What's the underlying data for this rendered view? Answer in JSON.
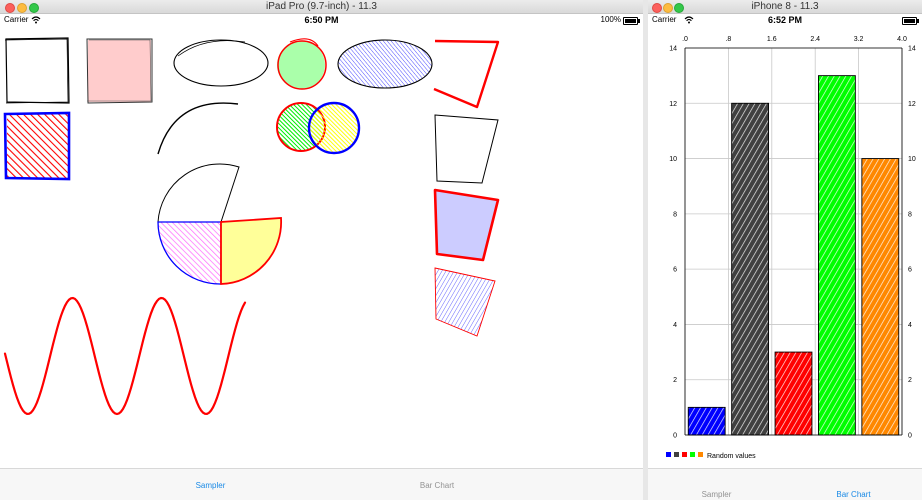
{
  "ipad": {
    "window_title": "iPad Pro (9.7-inch) - 11.3",
    "status": {
      "carrier": "Carrier",
      "time": "6:50 PM",
      "battery": "100%"
    },
    "tabs": [
      {
        "label": "Sampler",
        "selected": true
      },
      {
        "label": "Bar Chart",
        "selected": false
      }
    ],
    "shapes": [
      {
        "name": "rectangle",
        "stroke": "#000000",
        "fill": "none"
      },
      {
        "name": "filled-rectangle",
        "stroke": "#333333",
        "fill": "#ffcccc"
      },
      {
        "name": "ellipse",
        "stroke": "#000000",
        "fill": "none"
      },
      {
        "name": "circle-filled",
        "stroke": "#ff0000",
        "fill": "#aaffaa"
      },
      {
        "name": "ellipse-hachure",
        "stroke": "#000000",
        "fill": "#0000ff"
      },
      {
        "name": "polyline",
        "stroke": "#ff0000"
      },
      {
        "name": "rectangle-hachure",
        "stroke": "#0000ff",
        "fill": "#ff0000"
      },
      {
        "name": "arc",
        "stroke": "#000000"
      },
      {
        "name": "circle-green",
        "stroke": "#ff0000",
        "fill": "#00ff00"
      },
      {
        "name": "circle-yellow",
        "stroke": "#0000ff",
        "fill": "#ffff00"
      },
      {
        "name": "polygon-outline",
        "stroke": "#000000"
      },
      {
        "name": "pie-outline",
        "stroke": "#000000"
      },
      {
        "name": "pie-violet",
        "stroke": "#0000ff",
        "fill": "#ff88ff"
      },
      {
        "name": "pie-yellow",
        "stroke": "#ff0000",
        "fill": "#ffff88"
      },
      {
        "name": "polygon-lavender",
        "stroke": "#ff0000",
        "fill": "#ccccff"
      },
      {
        "name": "polygon-hachure",
        "stroke": "#ff0000",
        "fill": "#0000ff"
      },
      {
        "name": "sine-wave",
        "stroke": "#ff0000"
      }
    ]
  },
  "iphone": {
    "window_title": "iPhone 8 - 11.3",
    "status": {
      "carrier": "Carrier",
      "time": "6:52 PM"
    },
    "tabs": [
      {
        "label": "Sampler",
        "selected": false
      },
      {
        "label": "Bar Chart",
        "selected": true
      }
    ]
  },
  "chart_data": {
    "type": "bar",
    "categories": [
      ".0",
      ".8",
      "1.6",
      "2.4",
      "3.2",
      "4.0"
    ],
    "bars": [
      {
        "x": 0.0,
        "value": 1,
        "color": "#0000ff"
      },
      {
        "x": 1.0,
        "value": 12,
        "color": "#404040"
      },
      {
        "x": 2.0,
        "value": 3,
        "color": "#ff0000"
      },
      {
        "x": 3.0,
        "value": 13,
        "color": "#00ff00"
      },
      {
        "x": 4.0,
        "value": 10,
        "color": "#ff8800"
      }
    ],
    "x_ticks": [
      ".0",
      ".8",
      "1.6",
      "2.4",
      "3.2",
      "4.0"
    ],
    "y_ticks": [
      "0",
      "2",
      "4",
      "6",
      "8",
      "10",
      "12",
      "14"
    ],
    "ylim": [
      0,
      14
    ],
    "xlim": [
      -0.5,
      4.5
    ],
    "grid": true,
    "legend": {
      "label": "Random values",
      "colors": [
        "#0000ff",
        "#404040",
        "#ff0000",
        "#00ff00",
        "#ff8800"
      ],
      "position": "bottom-left"
    }
  }
}
